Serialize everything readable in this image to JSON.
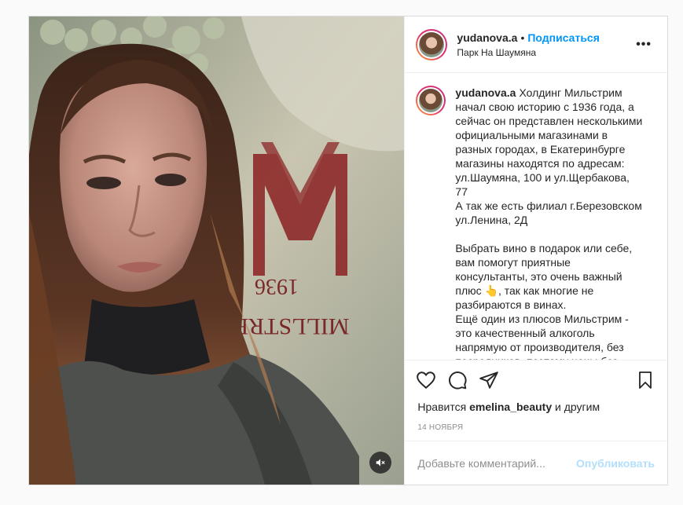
{
  "post": {
    "username": "yudanova.a",
    "dot": "•",
    "follow_label": "Подписаться",
    "location": "Парк На Шаумяна",
    "more_icon": "more-horizontal-icon",
    "more_label": "•••"
  },
  "caption": {
    "username": "yudanova.a",
    "text": "Холдинг Мильстрим начал свою историю с 1936 года, а сейчас он представлен несколькими официальными магазинами в разных городах, в Екатеринбурге магазины находятся по адресам: ул.Шаумяна, 100 и ул.Щербакова, 77\nА так же есть филиал г.Березовском ул.Ленина, 2Д\n\nВыбрать вино в подарок или себе, вам помогут приятные консультанты, это очень важный плюс 👆, так как многие не разбираются в винах.\nЕщё один из плюсов Мильстрим - это качественный алкоголь напрямую от производителя, без посредников, поэтому цены без наценки"
  },
  "media": {
    "logo_text": "1936",
    "logo_sub": "MILLSTREAM",
    "mute_icon": "speaker-muted-icon"
  },
  "likes": {
    "prefix": "Нравится",
    "user": "emelina_beauty",
    "suffix": "и другим"
  },
  "date": "14 ноября",
  "comment": {
    "placeholder": "Добавьте комментарий...",
    "publish_label": "Опубликовать"
  },
  "colors": {
    "accent": "#0095f6",
    "publish_disabled": "#b2dffc",
    "muted_text": "#8e8e8e",
    "border": "#dbdbdb"
  }
}
